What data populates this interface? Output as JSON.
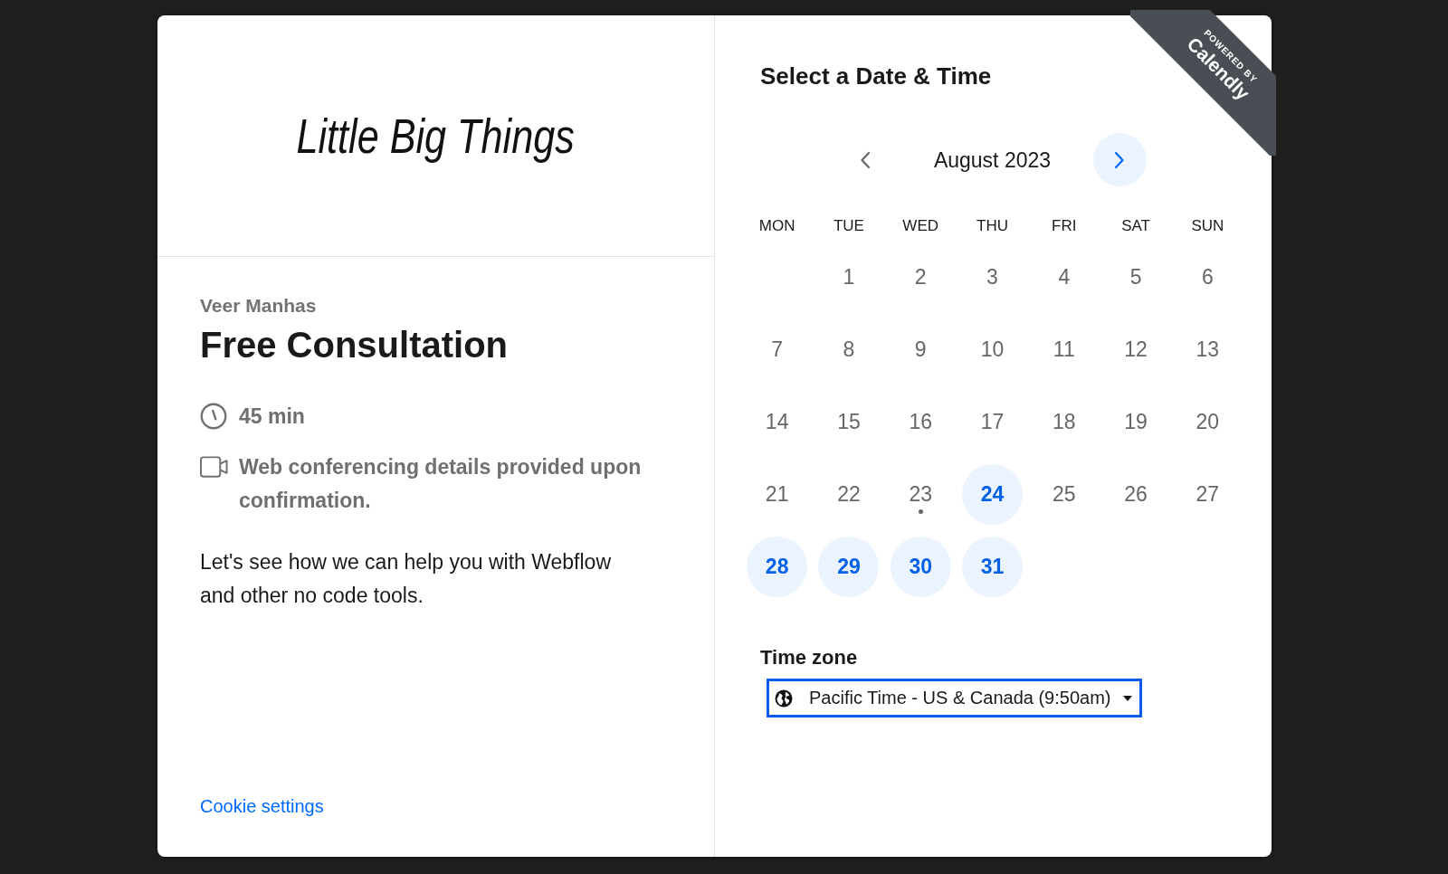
{
  "logo": "Little Big Things",
  "event": {
    "host": "Veer Manhas",
    "title": "Free Consultation",
    "details": [
      {
        "kind": "duration",
        "text": "45 min"
      },
      {
        "kind": "conferencing",
        "text": "Web conferencing details provided upon confirmation."
      }
    ],
    "description": "Let's see how we can help you with Webflow and other no code tools."
  },
  "footer_link": "Cookie settings",
  "scheduler": {
    "title": "Select a Date & Time",
    "month": "August 2023",
    "prev": {
      "disabled": true
    },
    "next": {
      "disabled": false
    },
    "weekdays": [
      "MON",
      "TUE",
      "WED",
      "THU",
      "FRI",
      "SAT",
      "SUN"
    ],
    "weeks": [
      [
        {
          "label": "1",
          "available": false,
          "today": false
        },
        {
          "label": "2",
          "available": false,
          "today": false
        },
        {
          "label": "3",
          "available": false,
          "today": false
        },
        {
          "label": "4",
          "available": false,
          "today": false
        },
        {
          "label": "5",
          "available": false,
          "today": false
        },
        {
          "label": "6",
          "available": false,
          "today": false
        }
      ],
      [
        {
          "label": "7",
          "available": false,
          "today": false
        },
        {
          "label": "8",
          "available": false,
          "today": false
        },
        {
          "label": "9",
          "available": false,
          "today": false
        },
        {
          "label": "10",
          "available": false,
          "today": false
        },
        {
          "label": "11",
          "available": false,
          "today": false
        },
        {
          "label": "12",
          "available": false,
          "today": false
        },
        {
          "label": "13",
          "available": false,
          "today": false
        }
      ],
      [
        {
          "label": "14",
          "available": false,
          "today": false
        },
        {
          "label": "15",
          "available": false,
          "today": false
        },
        {
          "label": "16",
          "available": false,
          "today": false
        },
        {
          "label": "17",
          "available": false,
          "today": false
        },
        {
          "label": "18",
          "available": false,
          "today": false
        },
        {
          "label": "19",
          "available": false,
          "today": false
        },
        {
          "label": "20",
          "available": false,
          "today": false
        }
      ],
      [
        {
          "label": "21",
          "available": false,
          "today": false
        },
        {
          "label": "22",
          "available": false,
          "today": false
        },
        {
          "label": "23",
          "available": false,
          "today": true
        },
        {
          "label": "24",
          "available": true,
          "today": false
        },
        {
          "label": "25",
          "available": false,
          "today": false
        },
        {
          "label": "26",
          "available": false,
          "today": false
        },
        {
          "label": "27",
          "available": false,
          "today": false
        }
      ],
      [
        {
          "label": "28",
          "available": true,
          "today": false
        },
        {
          "label": "29",
          "available": true,
          "today": false
        },
        {
          "label": "30",
          "available": true,
          "today": false
        },
        {
          "label": "31",
          "available": true,
          "today": false
        }
      ]
    ],
    "time_zone": {
      "label": "Time zone",
      "value": "Pacific Time - US & Canada (9:50am)",
      "focused": true
    }
  },
  "ribbon": {
    "overline": "POWERED BY",
    "brand": "Calendly"
  }
}
